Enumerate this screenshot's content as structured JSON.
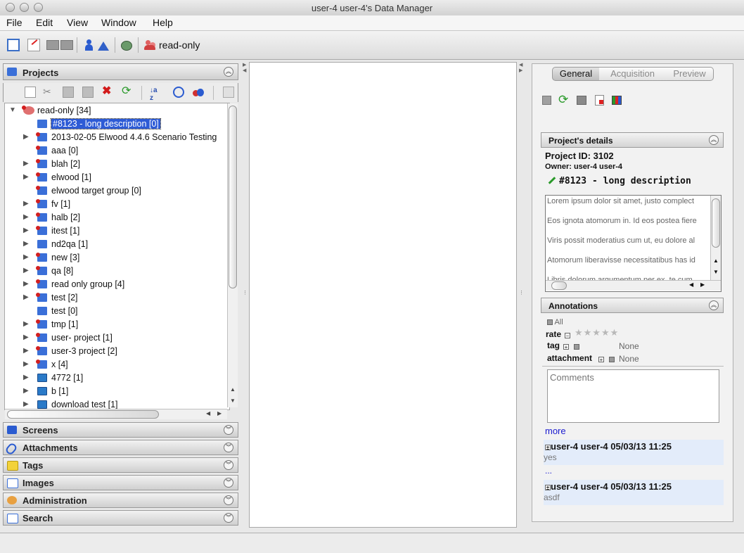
{
  "window": {
    "title": "user-4 user-4's Data Manager"
  },
  "menu": [
    "File",
    "Edit",
    "View",
    "Window",
    "Help"
  ],
  "toolbar": {
    "group_label": "read-only"
  },
  "left": {
    "projects_title": "Projects",
    "tree": [
      {
        "label": "read-only [34]",
        "level": 0,
        "arrow": "down",
        "icon": "group"
      },
      {
        "label": "#8123 - long description [0]",
        "level": 1,
        "arrow": "",
        "icon": "project-plain",
        "selected": true
      },
      {
        "label": "2013-02-05 Elwood 4.4.6 Scenario Testing",
        "level": 1,
        "arrow": "right",
        "icon": "project"
      },
      {
        "label": "aaa [0]",
        "level": 1,
        "arrow": "",
        "icon": "project"
      },
      {
        "label": "blah [2]",
        "level": 1,
        "arrow": "right",
        "icon": "project"
      },
      {
        "label": "elwood [1]",
        "level": 1,
        "arrow": "right",
        "icon": "project"
      },
      {
        "label": "elwood target group [0]",
        "level": 1,
        "arrow": "",
        "icon": "project"
      },
      {
        "label": "fv [1]",
        "level": 1,
        "arrow": "right",
        "icon": "project"
      },
      {
        "label": "halb [2]",
        "level": 1,
        "arrow": "right",
        "icon": "project"
      },
      {
        "label": "itest [1]",
        "level": 1,
        "arrow": "right",
        "icon": "project"
      },
      {
        "label": "nd2qa [1]",
        "level": 1,
        "arrow": "right",
        "icon": "project-plain"
      },
      {
        "label": "new [3]",
        "level": 1,
        "arrow": "right",
        "icon": "project"
      },
      {
        "label": "qa [8]",
        "level": 1,
        "arrow": "right",
        "icon": "project"
      },
      {
        "label": "read only group [4]",
        "level": 1,
        "arrow": "right",
        "icon": "project"
      },
      {
        "label": "test [2]",
        "level": 1,
        "arrow": "right",
        "icon": "project"
      },
      {
        "label": "test [0]",
        "level": 1,
        "arrow": "",
        "icon": "project-plain"
      },
      {
        "label": "tmp [1]",
        "level": 1,
        "arrow": "right",
        "icon": "project"
      },
      {
        "label": "user- project [1]",
        "level": 1,
        "arrow": "right",
        "icon": "project"
      },
      {
        "label": "user-3 project [2]",
        "level": 1,
        "arrow": "right",
        "icon": "project"
      },
      {
        "label": "x [4]",
        "level": 1,
        "arrow": "right",
        "icon": "project"
      },
      {
        "label": "4772 [1]",
        "level": 1,
        "arrow": "right",
        "icon": "screen"
      },
      {
        "label": "b [1]",
        "level": 1,
        "arrow": "right",
        "icon": "screen"
      },
      {
        "label": "download test [1]",
        "level": 1,
        "arrow": "right",
        "icon": "screen"
      }
    ],
    "sections": [
      "Screens",
      "Attachments",
      "Tags",
      "Images",
      "Administration",
      "Search"
    ]
  },
  "right": {
    "tabs": [
      "General",
      "Acquisition",
      "Preview"
    ],
    "details_title": "Project's details",
    "project_id": "Project ID: 3102",
    "owner": "Owner: user-4 user-4",
    "project_name": "#8123 - long description",
    "description_lines": [
      "Lorem ipsum dolor sit amet, justo complect",
      "Eos ignota atomorum in. Id eos postea fiere",
      "Viris possit moderatius cum ut, eu dolore al",
      "Atomorum liberavisse necessitatibus has id",
      "Libris dolorum argumentum per ex, te cum"
    ],
    "annotations_title": "Annotations",
    "all_label": "All",
    "rate_label": "rate",
    "tag_label": "tag",
    "tag_value": "None",
    "attachment_label": "attachment",
    "attachment_value": "None",
    "comments_placeholder": "Comments",
    "more_label": "more",
    "comments": [
      {
        "header": "user-4 user-4 05/03/13 11:25",
        "text": "yes"
      },
      {
        "header": "user-4 user-4 05/03/13 11:25",
        "text": "asdf"
      }
    ],
    "ellipsis": "..."
  },
  "colors": {
    "selection": "#2d5bd6",
    "link": "#1a1ad0",
    "comment_bg": "#e3ecfa"
  }
}
